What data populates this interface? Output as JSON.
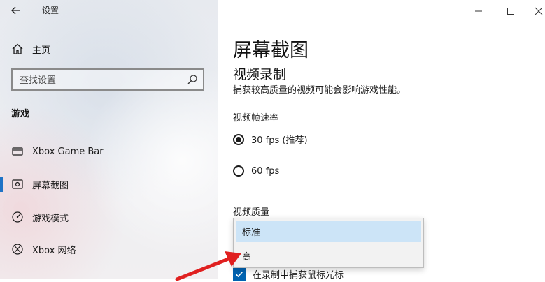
{
  "window": {
    "title": "设置"
  },
  "sidebar": {
    "home_label": "主页",
    "search_placeholder": "查找设置",
    "section_title": "游戏",
    "items": [
      {
        "label": "Xbox Game Bar",
        "icon": "gamebar-icon"
      },
      {
        "label": "屏幕截图",
        "icon": "screenshot-icon",
        "active": true
      },
      {
        "label": "游戏模式",
        "icon": "gamemode-icon"
      },
      {
        "label": "Xbox 网络",
        "icon": "xbox-icon"
      }
    ]
  },
  "main": {
    "page_title": "屏幕截图",
    "section_title": "视频录制",
    "section_desc": "捕获较高质量的视频可能会影响游戏性能。",
    "framerate": {
      "label": "视频帧速率",
      "options": [
        {
          "label": "30 fps (推荐)",
          "selected": true
        },
        {
          "label": "60 fps",
          "selected": false
        }
      ]
    },
    "quality": {
      "label": "视频质量",
      "options": [
        {
          "label": "标准",
          "highlighted": true
        },
        {
          "label": "高",
          "highlighted": false
        }
      ]
    },
    "capture_cursor": {
      "label": "在录制中捕获鼠标光标",
      "checked": true
    }
  },
  "colors": {
    "accent": "#0063b1",
    "selection": "#cce4f7",
    "arrow": "#e02020"
  }
}
